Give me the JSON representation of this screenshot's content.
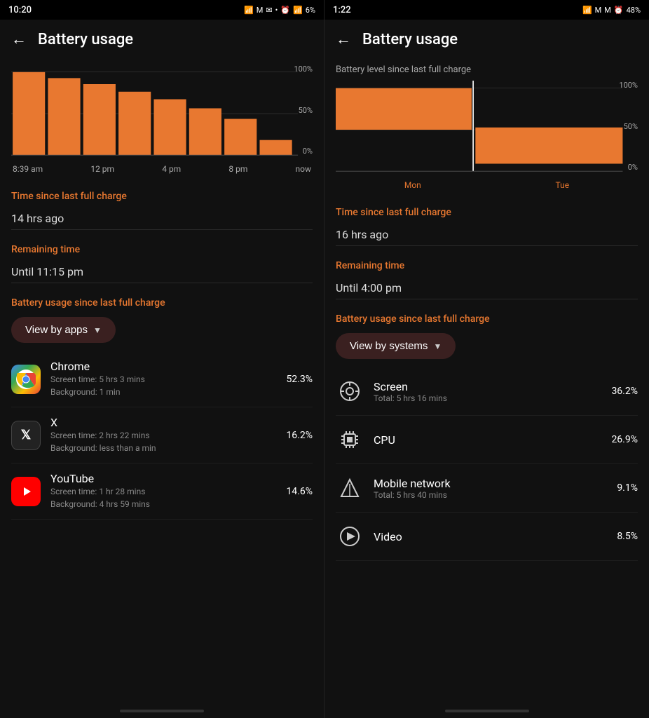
{
  "left": {
    "status": {
      "time": "10:20",
      "battery": "6%",
      "icons": "📶 M ✉ •"
    },
    "header": {
      "title": "Battery usage",
      "back_label": "←"
    },
    "chart": {
      "x_labels": [
        "8:39 am",
        "12 pm",
        "4 pm",
        "8 pm",
        "now"
      ],
      "y_labels": [
        "100%",
        "50%",
        "0%"
      ]
    },
    "time_since": {
      "label": "Time since last full charge",
      "value": "14 hrs ago"
    },
    "remaining": {
      "label": "Remaining time",
      "value": "Until 11:15 pm"
    },
    "since_charge": {
      "label": "Battery usage since last full charge"
    },
    "view_by_btn": "View by apps",
    "apps": [
      {
        "name": "Chrome",
        "details_line1": "Screen time: 5 hrs 3 mins",
        "details_line2": "Background: 1 min",
        "percent": "52.3%",
        "icon_type": "chrome"
      },
      {
        "name": "X",
        "details_line1": "Screen time: 2 hrs 22 mins",
        "details_line2": "Background: less than a min",
        "percent": "16.2%",
        "icon_type": "x-app"
      },
      {
        "name": "YouTube",
        "details_line1": "Screen time: 1 hr 28 mins",
        "details_line2": "Background: 4 hrs 59 mins",
        "percent": "14.6%",
        "icon_type": "youtube"
      }
    ]
  },
  "right": {
    "status": {
      "time": "1:22",
      "battery": "48%"
    },
    "header": {
      "title": "Battery usage",
      "back_label": "←"
    },
    "battery_level_label": "Battery level since last full charge",
    "chart": {
      "x_labels": [
        "Mon",
        "Tue"
      ],
      "y_labels": [
        "100%",
        "50%",
        "0%"
      ]
    },
    "time_since": {
      "label": "Time since last full charge",
      "value": "16 hrs ago"
    },
    "remaining": {
      "label": "Remaining time",
      "value": "Until 4:00 pm"
    },
    "since_charge": {
      "label": "Battery usage since last full charge"
    },
    "view_by_btn": "View by systems",
    "systems": [
      {
        "name": "Screen",
        "details": "Total: 5 hrs 16 mins",
        "percent": "36.2%",
        "icon": "brightness"
      },
      {
        "name": "CPU",
        "details": "",
        "percent": "26.9%",
        "icon": "cpu"
      },
      {
        "name": "Mobile network",
        "details": "Total: 5 hrs 40 mins",
        "percent": "9.1%",
        "icon": "signal"
      },
      {
        "name": "Video",
        "details": "",
        "percent": "8.5%",
        "icon": "video"
      }
    ]
  },
  "colors": {
    "orange": "#e87830",
    "chart_fill": "#e87830",
    "background": "#111111"
  }
}
